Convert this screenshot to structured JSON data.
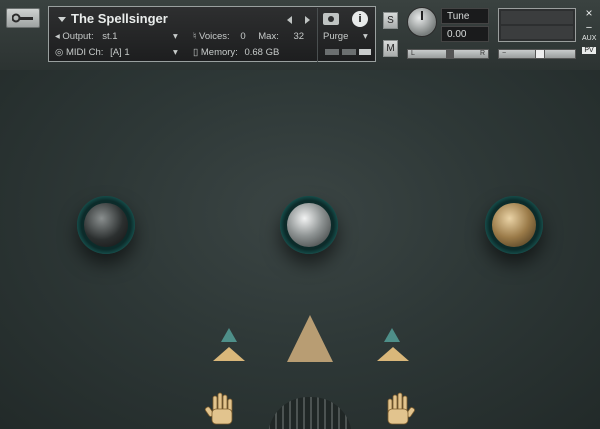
{
  "instrument": {
    "title": "The Spellsinger",
    "output_label": "Output:",
    "output_value": "st.1",
    "midi_label": "MIDI Ch:",
    "midi_value": "[A]  1",
    "voices_label": "Voices:",
    "voices_value": "0",
    "max_label": "Max:",
    "max_value": "32",
    "memory_label": "Memory:",
    "memory_value": "0.68 GB",
    "purge_label": "Purge",
    "info_glyph": "i"
  },
  "side_controls": {
    "solo_label": "S",
    "mute_label": "M",
    "tune_label": "Tune",
    "tune_value": "0.00",
    "pan_left": "L",
    "pan_right": "R",
    "aux_label": "AUX",
    "pv_label": "PV",
    "close_glyph": "×",
    "minus_glyph": "−"
  },
  "orbs": [
    {
      "name": "dark"
    },
    {
      "name": "silver"
    },
    {
      "name": "bronze"
    }
  ],
  "colors": {
    "background": "#2a3231",
    "orb_ring": "#16504d",
    "gold": "#d9b77a"
  }
}
